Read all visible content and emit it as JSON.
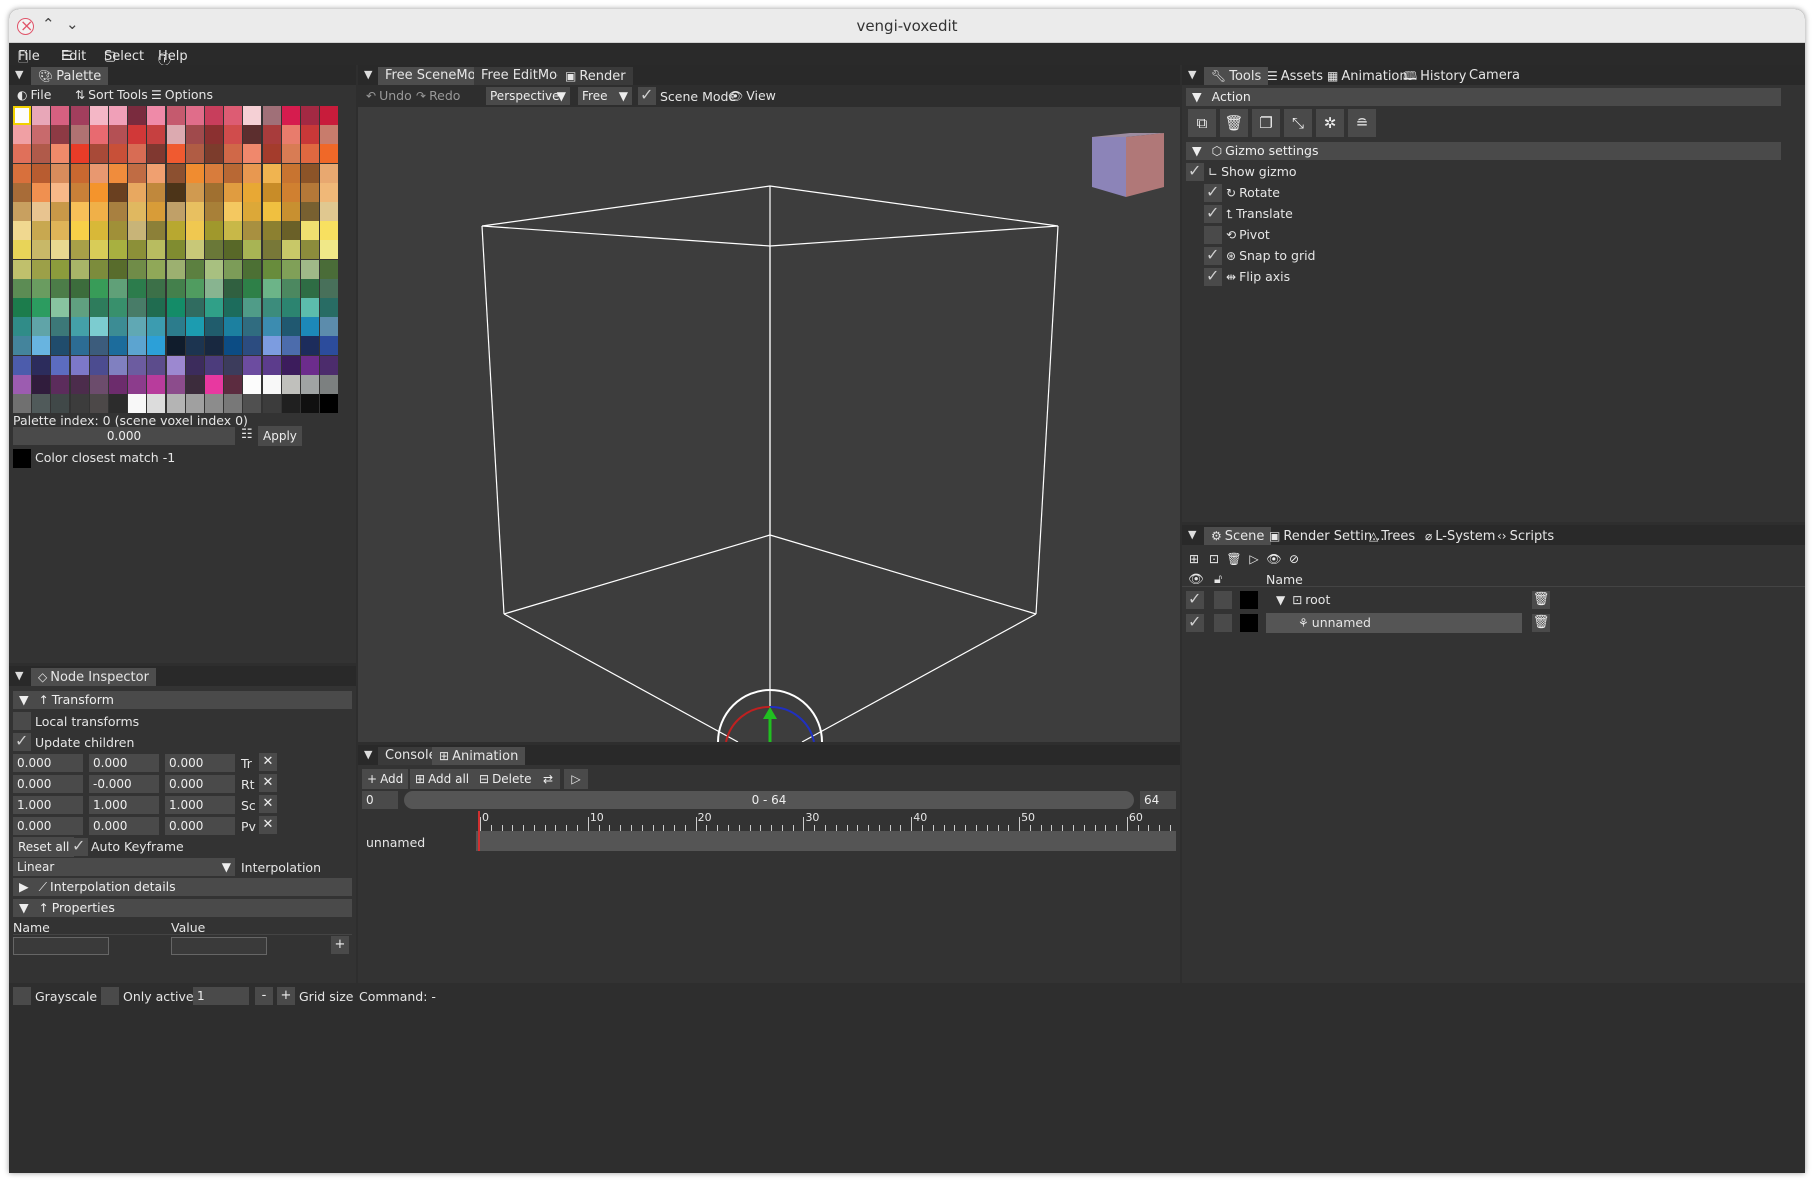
{
  "window": {
    "title": "vengi-voxedit"
  },
  "menu": [
    "File",
    "Edit",
    "Select",
    "Help"
  ],
  "palette": {
    "tab": "Palette",
    "toolbar": [
      "File",
      "Sort",
      "Tools",
      "Options"
    ],
    "colors": [
      "#fcfcfc",
      "#e8a7b8",
      "#d66080",
      "#a23e5d",
      "#f4b7c6",
      "#f0a0b8",
      "#7a2b3e",
      "#ef8aa8",
      "#c55a6e",
      "#e06d8a",
      "#c83e5c",
      "#dd5c73",
      "#f5d0d5",
      "#a07078",
      "#d61c4e",
      "#a32943",
      "#c81c3b",
      "#f0a0a4",
      "#c86a6c",
      "#8d3a44",
      "#b07272",
      "#e86a70",
      "#b45054",
      "#d13838",
      "#c64040",
      "#dcaab0",
      "#a04a4c",
      "#8b3030",
      "#d04c4c",
      "#5c2e2e",
      "#a83c3c",
      "#e87c6c",
      "#c83838",
      "#c87c6c",
      "#e0705a",
      "#b05a4a",
      "#f08a6a",
      "#e83c28",
      "#a84a38",
      "#c85038",
      "#d86c54",
      "#803830",
      "#f05a30",
      "#b05c44",
      "#7c3c2c",
      "#d06848",
      "#f0886c",
      "#a43c2c",
      "#d87c54",
      "#e06840",
      "#f06828",
      "#d8703c",
      "#b85c30",
      "#d88c5c",
      "#c86830",
      "#e89870",
      "#f08c3c",
      "#c06c44",
      "#f0a070",
      "#8c5030",
      "#f08c30",
      "#d87c3c",
      "#b86834",
      "#e89850",
      "#f0b450",
      "#c87430",
      "#8c5428",
      "#e8a870",
      "#a86c38",
      "#f09050",
      "#f8b888",
      "#c88038",
      "#f4942c",
      "#6a4020",
      "#e8a860",
      "#c0883c",
      "#4c3418",
      "#d09a50",
      "#a07030",
      "#e09c40",
      "#e8a834",
      "#c88c28",
      "#d08030",
      "#b47838",
      "#f0b878",
      "#c8a060",
      "#e8c490",
      "#c89848",
      "#f8c058",
      "#f0b048",
      "#a88040",
      "#e0b860",
      "#d89c38",
      "#c0a068",
      "#e8c060",
      "#a88038",
      "#f4c860",
      "#dca838",
      "#f0c040",
      "#c89030",
      "#786030",
      "#e0c890",
      "#f0d890",
      "#c8a850",
      "#e0b458",
      "#f8d048",
      "#d8b838",
      "#a09038",
      "#c8b478",
      "#8c8038",
      "#b8a830",
      "#f0c850",
      "#a0982c",
      "#c8b848",
      "#a89040",
      "#8c8030",
      "#6a6028",
      "#f0e070",
      "#f8e060",
      "#e8d458",
      "#c8b868",
      "#e8d890",
      "#a8a048",
      "#d8cc58",
      "#a8b040",
      "#8c9038",
      "#b8bc60",
      "#808c30",
      "#c8c878",
      "#6a7838",
      "#586828",
      "#a8b454",
      "#787838",
      "#c8c868",
      "#8c8c3c",
      "#f0e888",
      "#c0c06c",
      "#9ca048",
      "#8c9c3c",
      "#a8b468",
      "#7c8c3c",
      "#586c2c",
      "#708c48",
      "#90a858",
      "#9cb070",
      "#5c8040",
      "#a8c080",
      "#7c9c58",
      "#4c7034",
      "#688c3c",
      "#80a058",
      "#a0b888",
      "#4a6c38",
      "#5c8c54",
      "#6a9c60",
      "#4c7c48",
      "#3c6c3c",
      "#389c58",
      "#60a078",
      "#2c7c4c",
      "#3c7048",
      "#44804c",
      "#509c60",
      "#88b490",
      "#306040",
      "#2e8048",
      "#6cb488",
      "#4c8860",
      "#2e6c44",
      "#48705a",
      "#1c7c4c",
      "#2c9c60",
      "#88c4a0",
      "#60a080",
      "#2e7c5c",
      "#38906c",
      "#487c68",
      "#206c50",
      "#148c68",
      "#306c60",
      "#30a088",
      "#1c6c5c",
      "#509c88",
      "#3c8c7c",
      "#2c8470",
      "#5cbcac",
      "#286c64",
      "#308c88",
      "#60a4a8",
      "#3c7878",
      "#44a0a8",
      "#7cccd0",
      "#3c8c94",
      "#60a8b4",
      "#3c9cb0",
      "#2c7c8c",
      "#1c9cb0",
      "#205c6c",
      "#1c80a0",
      "#306c80",
      "#3c8cb0",
      "#205870",
      "#1c88b8",
      "#5c8cac",
      "#44849c",
      "#68b4e0",
      "#204c6c",
      "#2c6c94",
      "#3c5c7c",
      "#1c6c9c",
      "#5ca4d0",
      "#2ca0d8",
      "#101c2c",
      "#1c3450",
      "#182840",
      "#0c4c84",
      "#2c4c80",
      "#7c9ce0",
      "#4c6cac",
      "#1c2c5c",
      "#2c4c9c",
      "#4c5cac",
      "#2c2c5c",
      "#5c6cc0",
      "#7c78c8",
      "#4c4c90",
      "#8080c0",
      "#6c5ca0",
      "#5c4c8c",
      "#9c88d0",
      "#3c2c5c",
      "#4c3c7c",
      "#3c3c5c",
      "#6c4ca0",
      "#5c3c8c",
      "#3c1c5c",
      "#6c2c8c",
      "#4c2c6c",
      "#9c5cb0",
      "#301c3c",
      "#5c2c5c",
      "#4c2c4c",
      "#6c4c6c",
      "#6c2c6c",
      "#8c3c8c",
      "#b83c9c",
      "#8c4c8c",
      "#3c2c3c",
      "#e838a0",
      "#5c2c40",
      "#fcfcfc",
      "#f8f8f8",
      "#c0c0bc",
      "#a0a4a4",
      "#7c8080",
      "#707070",
      "#505a5a",
      "#404848",
      "#3c3c3c",
      "#4c4848",
      "#2c2c2c",
      "#f8f8f8",
      "#dcdcdc",
      "#b4b4b4",
      "#a0a0a0",
      "#8c8c8c",
      "#787878",
      "#505050",
      "#3c3c3c",
      "#202020",
      "#101010",
      "#000000"
    ],
    "index_text": "Palette index: 0 (scene voxel index 0)",
    "value": "0.000",
    "apply": "Apply",
    "closest": "Color closest match  -1"
  },
  "viewport": {
    "tabs": [
      "Free SceneMode",
      "Free EditMode",
      "Render"
    ],
    "undo": "Undo",
    "redo": "Redo",
    "camera": "Perspective",
    "mode": "Free",
    "scene_mode": "Scene Mode",
    "view": "View"
  },
  "inspector": {
    "tab": "Node Inspector",
    "transform": "Transform",
    "local": "Local transforms",
    "update": "Update children",
    "rows": [
      {
        "v": [
          "0.000",
          "0.000",
          "0.000"
        ],
        "l": "Tr"
      },
      {
        "v": [
          "0.000",
          "-0.000",
          "0.000"
        ],
        "l": "Rt"
      },
      {
        "v": [
          "1.000",
          "1.000",
          "1.000"
        ],
        "l": "Sc"
      },
      {
        "v": [
          "0.000",
          "0.000",
          "0.000"
        ],
        "l": "Pv"
      }
    ],
    "reset": "Reset all",
    "auto_key": "Auto Keyframe",
    "interp_value": "Linear",
    "interp_label": "Interpolation",
    "interp_details": "Interpolation details",
    "properties": "Properties",
    "col_name": "Name",
    "col_value": "Value",
    "add": "+"
  },
  "timeline": {
    "tabs": [
      "Console",
      "Animation"
    ],
    "add": "Add",
    "add_all": "Add all",
    "delete": "Delete",
    "start": "0",
    "range": "0 - 64",
    "end": "64",
    "ticks": [
      "0",
      "10",
      "20",
      "30",
      "40",
      "50",
      "60"
    ],
    "node": "unnamed"
  },
  "tools": {
    "tabs": [
      "Tools",
      "Assets",
      "Animation",
      "History",
      "Camera"
    ],
    "action": "Action",
    "gizmo": "Gizmo settings",
    "show_gizmo": "Show gizmo",
    "options": [
      {
        "label": "Rotate",
        "on": true
      },
      {
        "label": "Translate",
        "on": true
      },
      {
        "label": "Pivot",
        "on": false
      },
      {
        "label": "Snap to grid",
        "on": true
      },
      {
        "label": "Flip axis",
        "on": true
      }
    ]
  },
  "scene": {
    "tabs": [
      "Scene",
      "Render Settin...",
      "Trees",
      "L-System",
      "Scripts"
    ],
    "col_name": "Name",
    "nodes": [
      "root",
      "unnamed"
    ]
  },
  "status": {
    "grayscale": "Grayscale",
    "only_active": "Only active",
    "grid_value": "1",
    "minus": "-",
    "plus": "+",
    "grid_size": "Grid size",
    "command": "Command: -"
  }
}
